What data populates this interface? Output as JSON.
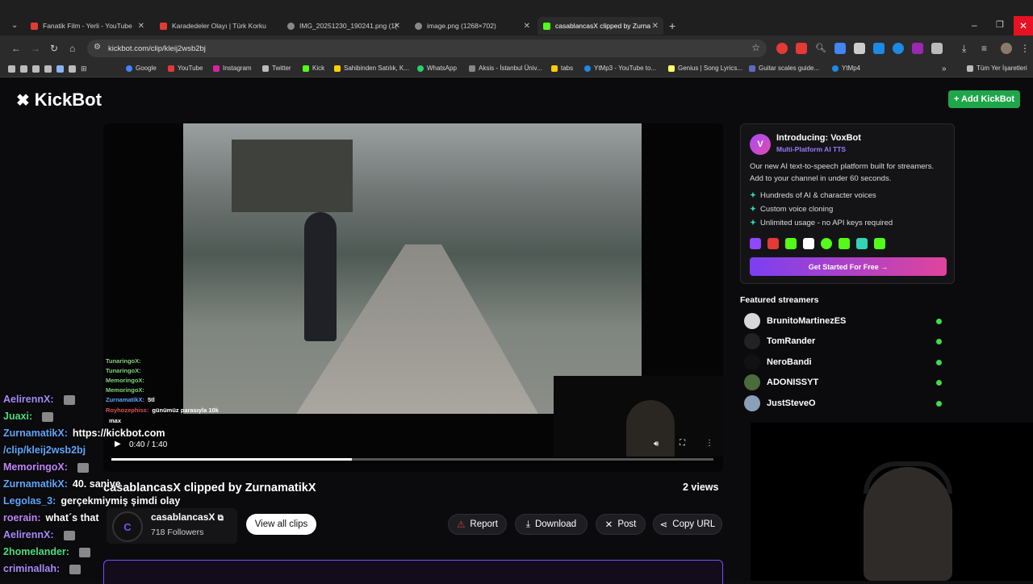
{
  "tabs": [
    {
      "label": "Fanatik Film - Yerli - YouTube",
      "favcolor": "#e53935"
    },
    {
      "label": "Karadedeler Olayı | Türk Korku",
      "favcolor": "#e53935"
    },
    {
      "label": "IMG_20251230_190241.png (1(",
      "favcolor": "#888888"
    },
    {
      "label": "image.png (1268×702)",
      "favcolor": "#888888"
    },
    {
      "label": "casablancasX clipped by Zurna",
      "favcolor": "#53fc18"
    }
  ],
  "address": {
    "url": "kickbot.com/clip/kleij2wsb2bj"
  },
  "bookmarks": [
    {
      "label": "Google",
      "color": "#4285f4"
    },
    {
      "label": "YouTube",
      "color": "#e53935"
    },
    {
      "label": "Instagram",
      "color": "#d6249f"
    },
    {
      "label": "Twitter",
      "color": "#bbbbbb"
    },
    {
      "label": "Kick",
      "color": "#53fc18"
    },
    {
      "label": "Sahibinden Satılık, K...",
      "color": "#ffd000"
    },
    {
      "label": "WhatsApp",
      "color": "#25d366"
    },
    {
      "label": "Aksis - İstanbul Üniv...",
      "color": "#888888"
    },
    {
      "label": "tabs",
      "color": "#ffcc00"
    },
    {
      "label": "YtMp3 - YouTube to...",
      "color": "#1e88e5"
    },
    {
      "label": "Genius | Song Lyrics...",
      "color": "#ffff64"
    },
    {
      "label": "Guitar scales guide...",
      "color": "#5c6bc0"
    },
    {
      "label": "YtMp4",
      "color": "#1e88e5"
    }
  ],
  "bookmarks_all": "Tüm Yer İşaretleri",
  "site": {
    "logo": "KickBot",
    "add_button": "+ Add KickBot",
    "clip_title": "casablancasX clipped by ZurnamatikX",
    "views": "2 views",
    "channel": "casablancasX",
    "channel_initial": "C",
    "followers": "718 Followers",
    "view_all": "View all clips",
    "report": "Report",
    "download": "Download",
    "post": "Post",
    "copy_url": "Copy URL"
  },
  "video": {
    "time": "0:40 / 1:40",
    "progress": 0.4
  },
  "video_chat": [
    {
      "user": "TunaringoX:",
      "text": ""
    },
    {
      "user": "TunaringoX:",
      "text": ""
    },
    {
      "user": "MemoringoX:",
      "text": ""
    },
    {
      "user": "MemoringoX:",
      "text": ""
    },
    {
      "user": "ZurnamatikX:",
      "text": "5tl"
    },
    {
      "user": "Royhozephiss:",
      "text": "günümüz parasıyla 10k"
    },
    {
      "user": "",
      "text": "max"
    }
  ],
  "ad": {
    "title": "Introducing: VoxBot",
    "subtitle": "Multi-Platform AI TTS",
    "body": "Our new AI text-to-speech platform built for streamers. Add to your channel in under 60 seconds.",
    "features": [
      "Hundreds of AI & character voices",
      "Custom voice cloning",
      "Unlimited usage - no API keys required"
    ],
    "cta": "Get Started For Free →",
    "platform_colors": [
      "#9146ff",
      "#e53935",
      "#53fc18",
      "#ffffff",
      "#53fc18",
      "#53fc18",
      "#33d3b5",
      "#53fc18"
    ]
  },
  "featured_title": "Featured streamers",
  "streamers": [
    {
      "name": "BrunitoMartinezES"
    },
    {
      "name": "TomRander"
    },
    {
      "name": "NeroBandi"
    },
    {
      "name": "ADONISSYT"
    },
    {
      "name": "JustSteveO"
    }
  ],
  "chat_overlay": [
    {
      "user": "AelirennX:",
      "text": "",
      "color": "#a78bfa"
    },
    {
      "user": "Juaxi:",
      "text": "",
      "color": "#4ade80"
    },
    {
      "user": "ZurnamatikX:",
      "text": "https://kickbot.com",
      "color": "#60a5fa"
    },
    {
      "user": "",
      "text": "/clip/kleij2wsb2bj",
      "color": "#60a5fa"
    },
    {
      "user": "MemoringoX:",
      "text": "",
      "color": "#c084fc"
    },
    {
      "user": "ZurnamatikX:",
      "text": "40. saniye",
      "color": "#60a5fa"
    },
    {
      "user": "Legolas_3:",
      "text": "gerçekmiymiş şimdi olay",
      "color": "#60a5fa"
    },
    {
      "user": "roerain:",
      "text": "what´s that",
      "color": "#c084fc"
    },
    {
      "user": "AelirennX:",
      "text": "",
      "color": "#a78bfa"
    },
    {
      "user": "2homelander:",
      "text": "",
      "color": "#4ade80"
    },
    {
      "user": "criminallah:",
      "text": "",
      "color": "#a78bfa"
    }
  ]
}
